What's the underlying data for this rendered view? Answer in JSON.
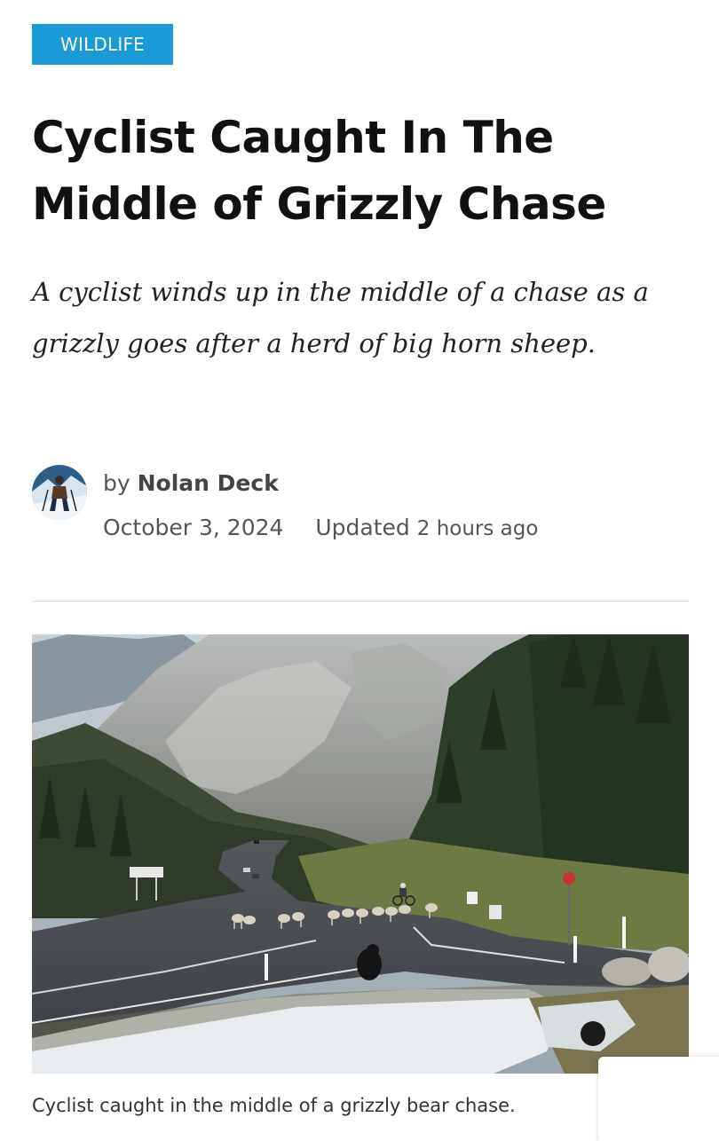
{
  "article": {
    "category": "WILDLIFE",
    "title": "Cyclist Caught In The Middle of Grizzly Chase",
    "subtitle": "A cyclist winds up in the middle of a chase as a grizzly goes after a herd of big horn sheep.",
    "byline_prefix": "by",
    "author": "Nolan Deck",
    "date": "October 3, 2024",
    "updated_label": "Updated",
    "updated_ago": "2 hours ago",
    "image_caption": "Cyclist caught in the middle of a grizzly bear chase.",
    "image_alt": "Grizzly bear chasing big horn sheep across a mountain road while a cyclist rides past"
  },
  "colors": {
    "accent": "#1a9ad6",
    "title_text": "#111111",
    "meta_text": "#555555",
    "divider": "#dddddd"
  },
  "icons": {
    "avatar": "author-avatar-photo"
  }
}
